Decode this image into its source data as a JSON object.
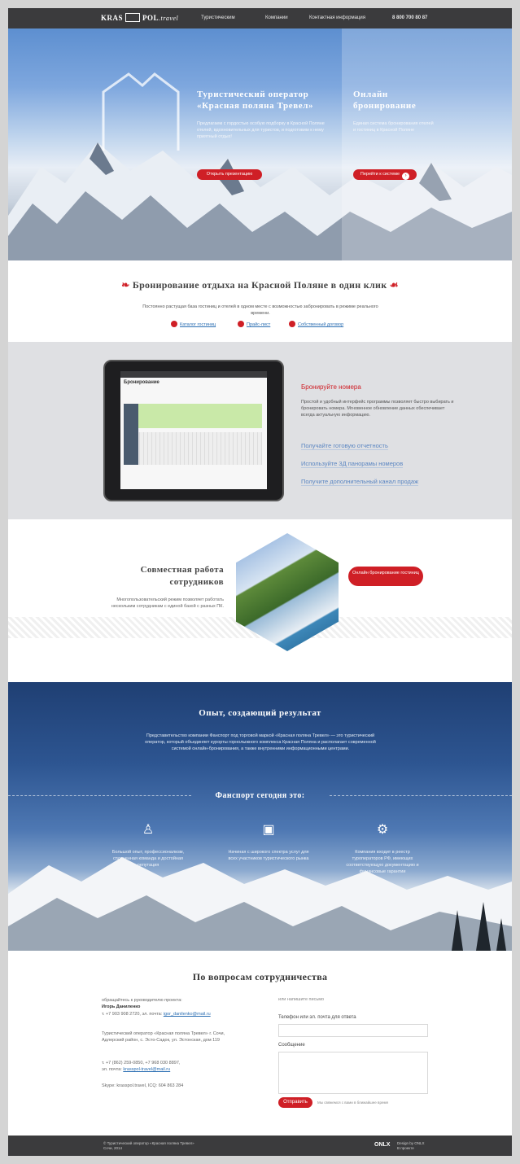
{
  "header": {
    "logo_left": "KRAS",
    "logo_right": "POL",
    "logo_suffix": ".travel",
    "nav": [
      "Туристическим",
      "Компании",
      "Контактная информация"
    ],
    "phone": "8 800 700 80 87"
  },
  "hero": {
    "left_title": "Туристический оператор «Красная поляна Тревел»",
    "left_text": "Предлагаем с гордостью особую подборку в Красной Поляне отелей, вдохновительных для туристов, и подготовим к нему приятный отдых!",
    "left_button": "Открыть презентацию",
    "right_title": "Онлайн бронирование",
    "right_text": "Единая система бронирования отелей и гостиниц в Красной Поляне",
    "right_button": "Перейти к системе"
  },
  "booking": {
    "title": "Бронирование отдыха на Красной Поляне в один клик",
    "subtitle": "Постоянно растущая база гостиниц и отелей в одном месте с возможностью забронировать в режиме реального времени.",
    "links": [
      "Каталог гостиниц",
      "Прайс-лист",
      "Собственный договор"
    ]
  },
  "ipad": {
    "screen_title": "Бронирование",
    "heading": "Бронируйте номера",
    "text": "Простой и удобный интерфейс программы позволяет быстро выбирать и бронировать номера. Мгновенное обновление данных обеспечивает всегда актуальную информацию.",
    "features": [
      "Получайте готовую отчетность",
      "Используйте 3Д панорамы номеров",
      "Получите дополнительный канал продаж"
    ]
  },
  "collab": {
    "title": "Совместная работа сотрудников",
    "text": "Многопользовательский режим позволяет работать нескольким сотрудникам с единой базой с разных ПК.",
    "button": "Онлайн бронирование гостиниц"
  },
  "experience": {
    "title": "Опыт, создающий результат",
    "text": "Представительство компании Фанспорт под торговой маркой «Красная поляна Тревел» — это туристический оператор, который объединяет курорты горнолыжного комплекса Красная Поляна и располагает современной системой онлайн-бронирования, а также внутренними информационными центрами.",
    "subtitle": "Фанспорт сегодня это:",
    "features": [
      "Большой опыт, профессионализм, сплоченная команда и достойная репутация",
      "Начиная с широкого спектра услуг для всех участников туристического рынка",
      "Компания входит в реестр туроператоров РФ, имеющих соответствующую документацию и финансовые гарантии"
    ]
  },
  "contact": {
    "title": "По вопросам сотрудничества",
    "intro": "обращайтесь к руководителю проекта:",
    "name": "Игорь Даниленко",
    "phone_line": "т. +7 903 908 2720, эл. почта:",
    "email1": "igor_danilenko@mail.ru",
    "company": "Туристический оператор «Красная поляна Тревел» г. Сочи, Адлерский район, с. Эсто-Садок, ул. Эстонская, дом 119",
    "phones": "т. +7 (862) 259-0850, +7 968 030 8897,",
    "email_label": "эл. почта:",
    "email2": "krasspol-travel@mail.ru",
    "skype": "Skype: krasspol.travel, ICQ: 604 863 284",
    "form_intro": "или напишите письмо",
    "field1": "Телефон или эл. почта для ответа",
    "field2": "Сообщение",
    "send": "Отправить",
    "note": "Мы свяжемся с вами в ближайшее время"
  },
  "footer": {
    "copyright": "© Туристический оператор «Красная поляна Тревел»",
    "city": "Сочи, 2014",
    "brand": "ONLX",
    "design1": "Design by ONLX",
    "design2": "В проекте"
  },
  "colors": {
    "accent": "#cf1f26",
    "dark": "#3b3b3d",
    "link": "#2c6fb3"
  }
}
